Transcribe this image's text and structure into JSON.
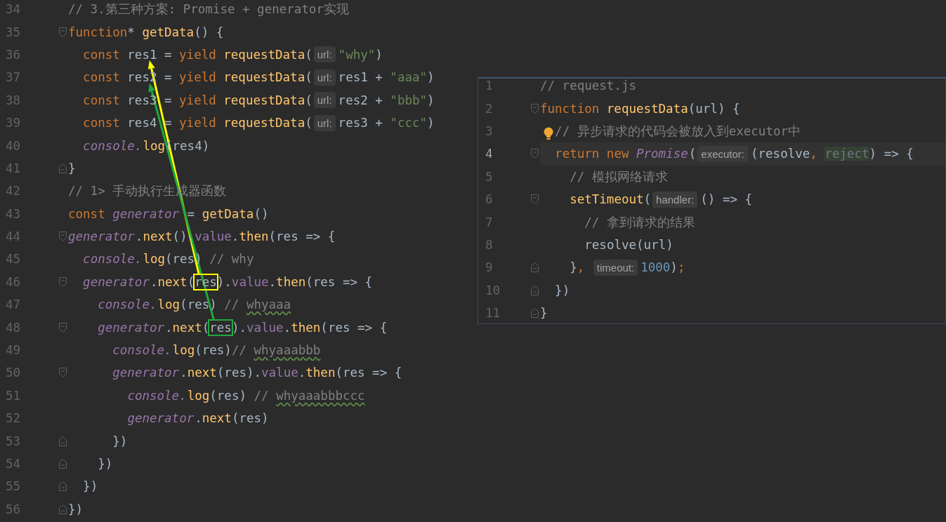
{
  "editors": [
    {
      "kind": "main",
      "lines": [
        {
          "number": "34",
          "tokens": [
            {
              "kind": "comment",
              "text": "// 3.第三种方案: Promise + generator实现"
            }
          ]
        },
        {
          "number": "35",
          "tokens": [
            {
              "kind": "keyword",
              "text": "function"
            },
            {
              "kind": "plain",
              "text": "* "
            },
            {
              "kind": "fn",
              "text": "getData"
            },
            {
              "kind": "plain",
              "text": "() {"
            }
          ],
          "children": [
            {
              "number": "36",
              "tokens": [
                {
                  "kind": "keyword",
                  "text": "const "
                },
                {
                  "kind": "plain",
                  "text": "res1",
                  "arrow_target": true,
                  "color": "#ffff00"
                },
                {
                  "kind": "plain",
                  "text": " = "
                },
                {
                  "kind": "keyword",
                  "text": "yield "
                },
                {
                  "kind": "fn",
                  "text": "requestData"
                },
                {
                  "kind": "plain",
                  "text": "("
                },
                {
                  "kind": "hint",
                  "text": "url:"
                },
                {
                  "kind": "string",
                  "text": "\"why\""
                },
                {
                  "kind": "plain",
                  "text": ")"
                }
              ]
            },
            {
              "number": "37",
              "tokens": [
                {
                  "kind": "keyword",
                  "text": "const "
                },
                {
                  "kind": "plain",
                  "text": "res2",
                  "arrow_target": true,
                  "color": "#20a83c"
                },
                {
                  "kind": "plain",
                  "text": " = "
                },
                {
                  "kind": "keyword",
                  "text": "yield "
                },
                {
                  "kind": "fn",
                  "text": "requestData"
                },
                {
                  "kind": "plain",
                  "text": "("
                },
                {
                  "kind": "hint",
                  "text": "url:"
                },
                {
                  "kind": "plain",
                  "text": "res1 + "
                },
                {
                  "kind": "string",
                  "text": "\"aaa\""
                },
                {
                  "kind": "plain",
                  "text": ")"
                }
              ]
            },
            {
              "number": "38",
              "tokens": [
                {
                  "kind": "keyword",
                  "text": "const "
                },
                {
                  "kind": "plain",
                  "text": "res3 = "
                },
                {
                  "kind": "keyword",
                  "text": "yield "
                },
                {
                  "kind": "fn",
                  "text": "requestData"
                },
                {
                  "kind": "plain",
                  "text": "("
                },
                {
                  "kind": "hint",
                  "text": "url:"
                },
                {
                  "kind": "plain",
                  "text": "res2 + "
                },
                {
                  "kind": "string",
                  "text": "\"bbb\""
                },
                {
                  "kind": "plain",
                  "text": ")"
                }
              ]
            },
            {
              "number": "39",
              "tokens": [
                {
                  "kind": "keyword",
                  "text": "const "
                },
                {
                  "kind": "plain",
                  "text": "res4 = "
                },
                {
                  "kind": "keyword",
                  "text": "yield "
                },
                {
                  "kind": "fn",
                  "text": "requestData"
                },
                {
                  "kind": "plain",
                  "text": "("
                },
                {
                  "kind": "hint",
                  "text": "url:"
                },
                {
                  "kind": "plain",
                  "text": "res3 + "
                },
                {
                  "kind": "string",
                  "text": "\"ccc\""
                },
                {
                  "kind": "plain",
                  "text": ")"
                }
              ]
            },
            {
              "number": "40",
              "tokens": [
                {
                  "kind": "italic",
                  "text": "console."
                },
                {
                  "kind": "fn",
                  "text": "log"
                },
                {
                  "kind": "plain",
                  "text": "(res4)"
                }
              ]
            }
          ]
        },
        {
          "number": "41",
          "closes": true,
          "tokens": [
            {
              "kind": "plain",
              "text": "}"
            }
          ]
        },
        {
          "number": "42",
          "tokens": [
            {
              "kind": "comment",
              "text": "// 1> 手动执行生成器函数"
            }
          ]
        },
        {
          "number": "43",
          "tokens": [
            {
              "kind": "keyword",
              "text": "const "
            },
            {
              "kind": "italic",
              "text": "generator"
            },
            {
              "kind": "plain",
              "text": " = "
            },
            {
              "kind": "fn",
              "text": "getData"
            },
            {
              "kind": "plain",
              "text": "()"
            }
          ]
        },
        {
          "number": "44",
          "tokens": [
            {
              "kind": "italic",
              "text": "generator"
            },
            {
              "kind": "plain",
              "text": "."
            },
            {
              "kind": "fn",
              "text": "next"
            },
            {
              "kind": "plain",
              "text": "()."
            },
            {
              "kind": "prop",
              "text": "value"
            },
            {
              "kind": "plain",
              "text": "."
            },
            {
              "kind": "fn",
              "text": "then"
            },
            {
              "kind": "plain",
              "text": "(res => {"
            }
          ],
          "children": [
            {
              "number": "45",
              "tokens": [
                {
                  "kind": "italic",
                  "text": "console."
                },
                {
                  "kind": "fn",
                  "text": "log"
                },
                {
                  "kind": "plain",
                  "text": "(res) "
                },
                {
                  "kind": "comment",
                  "text": "// why"
                }
              ]
            },
            {
              "number": "46",
              "tokens": [
                {
                  "kind": "italic",
                  "text": "generator"
                },
                {
                  "kind": "plain",
                  "text": "."
                },
                {
                  "kind": "fn",
                  "text": "next"
                },
                {
                  "kind": "plain",
                  "text": "("
                },
                {
                  "kind": "plain",
                  "text": "res",
                  "boxed": true,
                  "color": "#ffff00"
                },
                {
                  "kind": "plain",
                  "text": ")."
                },
                {
                  "kind": "prop",
                  "text": "value"
                },
                {
                  "kind": "plain",
                  "text": "."
                },
                {
                  "kind": "fn",
                  "text": "then"
                },
                {
                  "kind": "plain",
                  "text": "(res => {"
                }
              ],
              "children": [
                {
                  "number": "47",
                  "tokens": [
                    {
                      "kind": "italic",
                      "text": "console."
                    },
                    {
                      "kind": "fn",
                      "text": "log"
                    },
                    {
                      "kind": "plain",
                      "text": "(res) "
                    },
                    {
                      "kind": "comment",
                      "text": "// "
                    },
                    {
                      "kind": "typo",
                      "text": "whyaaa"
                    }
                  ]
                },
                {
                  "number": "48",
                  "tokens": [
                    {
                      "kind": "italic",
                      "text": "generator"
                    },
                    {
                      "kind": "plain",
                      "text": "."
                    },
                    {
                      "kind": "fn",
                      "text": "next"
                    },
                    {
                      "kind": "plain",
                      "text": "("
                    },
                    {
                      "kind": "plain",
                      "text": "res",
                      "boxed": true,
                      "color": "#20a83c"
                    },
                    {
                      "kind": "plain",
                      "text": ")."
                    },
                    {
                      "kind": "prop",
                      "text": "value"
                    },
                    {
                      "kind": "plain",
                      "text": "."
                    },
                    {
                      "kind": "fn",
                      "text": "then"
                    },
                    {
                      "kind": "plain",
                      "text": "(res => {"
                    }
                  ],
                  "children": [
                    {
                      "number": "49",
                      "tokens": [
                        {
                          "kind": "italic",
                          "text": "console."
                        },
                        {
                          "kind": "fn",
                          "text": "log"
                        },
                        {
                          "kind": "plain",
                          "text": "(res)"
                        },
                        {
                          "kind": "comment",
                          "text": "// "
                        },
                        {
                          "kind": "typo",
                          "text": "whyaaabbb"
                        }
                      ]
                    },
                    {
                      "number": "50",
                      "tokens": [
                        {
                          "kind": "italic",
                          "text": "generator"
                        },
                        {
                          "kind": "plain",
                          "text": "."
                        },
                        {
                          "kind": "fn",
                          "text": "next"
                        },
                        {
                          "kind": "plain",
                          "text": "(res)."
                        },
                        {
                          "kind": "prop",
                          "text": "value"
                        },
                        {
                          "kind": "plain",
                          "text": "."
                        },
                        {
                          "kind": "fn",
                          "text": "then"
                        },
                        {
                          "kind": "plain",
                          "text": "(res => {"
                        }
                      ],
                      "children": [
                        {
                          "number": "51",
                          "tokens": [
                            {
                              "kind": "italic",
                              "text": "console."
                            },
                            {
                              "kind": "fn",
                              "text": "log"
                            },
                            {
                              "kind": "plain",
                              "text": "(res) "
                            },
                            {
                              "kind": "comment",
                              "text": "// "
                            },
                            {
                              "kind": "typo",
                              "text": "whyaaabbbccc"
                            }
                          ]
                        },
                        {
                          "number": "52",
                          "tokens": [
                            {
                              "kind": "italic",
                              "text": "generator"
                            },
                            {
                              "kind": "plain",
                              "text": "."
                            },
                            {
                              "kind": "fn",
                              "text": "next"
                            },
                            {
                              "kind": "plain",
                              "text": "(res)"
                            }
                          ]
                        }
                      ]
                    },
                    {
                      "number": "53",
                      "closes": true,
                      "tokens": [
                        {
                          "kind": "plain",
                          "text": "})"
                        }
                      ]
                    }
                  ]
                },
                {
                  "number": "54",
                  "closes": true,
                  "tokens": [
                    {
                      "kind": "plain",
                      "text": "})"
                    }
                  ]
                }
              ]
            },
            {
              "number": "55",
              "closes": true,
              "tokens": [
                {
                  "kind": "plain",
                  "text": "})"
                }
              ]
            }
          ]
        },
        {
          "number": "56",
          "closes": true,
          "tokens": [
            {
              "kind": "plain",
              "text": "})"
            }
          ]
        }
      ]
    },
    {
      "kind": "popup",
      "lines": [
        {
          "number": "1",
          "tokens": [
            {
              "kind": "comment",
              "text": "// request.js"
            }
          ]
        },
        {
          "number": "2",
          "tokens": [
            {
              "kind": "keyword",
              "text": "function "
            },
            {
              "kind": "fn",
              "text": "requestData"
            },
            {
              "kind": "plain",
              "text": "(url) {"
            }
          ],
          "children": [
            {
              "number": "3",
              "bulb": true,
              "tokens": [
                {
                  "kind": "comment",
                  "text": "// 异步请求的代码会被放入到executor中"
                }
              ]
            },
            {
              "number": "4",
              "current": true,
              "tokens": [
                {
                  "kind": "keyword",
                  "text": "return new "
                },
                {
                  "kind": "italic",
                  "text": "Promise"
                },
                {
                  "kind": "plain",
                  "text": "("
                },
                {
                  "kind": "hint",
                  "text": "executor:"
                },
                {
                  "kind": "plain",
                  "text": "(resolve"
                },
                {
                  "kind": "keyword",
                  "text": ", "
                },
                {
                  "kind": "unused",
                  "text": "reject"
                },
                {
                  "kind": "plain",
                  "text": ") => {"
                }
              ],
              "children": [
                {
                  "number": "5",
                  "tokens": [
                    {
                      "kind": "comment",
                      "text": "// 模拟网络请求"
                    }
                  ]
                },
                {
                  "number": "6",
                  "tokens": [
                    {
                      "kind": "fn",
                      "text": "setTimeout"
                    },
                    {
                      "kind": "plain",
                      "text": "("
                    },
                    {
                      "kind": "hint",
                      "text": "handler:"
                    },
                    {
                      "kind": "plain",
                      "text": "() => {"
                    }
                  ],
                  "children": [
                    {
                      "number": "7",
                      "tokens": [
                        {
                          "kind": "comment",
                          "text": "// 拿到请求的结果"
                        }
                      ]
                    },
                    {
                      "number": "8",
                      "tokens": [
                        {
                          "kind": "plain",
                          "text": "resolve(url)"
                        }
                      ]
                    }
                  ]
                },
                {
                  "number": "9",
                  "closes": true,
                  "tokens": [
                    {
                      "kind": "plain",
                      "text": "}"
                    },
                    {
                      "kind": "keyword",
                      "text": ", "
                    },
                    {
                      "kind": "hint",
                      "text": "timeout:"
                    },
                    {
                      "kind": "number",
                      "text": "1000"
                    },
                    {
                      "kind": "plain",
                      "text": ")"
                    },
                    {
                      "kind": "keyword",
                      "text": ";"
                    }
                  ]
                }
              ]
            },
            {
              "number": "10",
              "closes": true,
              "tokens": [
                {
                  "kind": "plain",
                  "text": "})"
                }
              ]
            }
          ]
        },
        {
          "number": "11",
          "closes": true,
          "tokens": [
            {
              "kind": "plain",
              "text": "}"
            }
          ]
        }
      ]
    }
  ]
}
